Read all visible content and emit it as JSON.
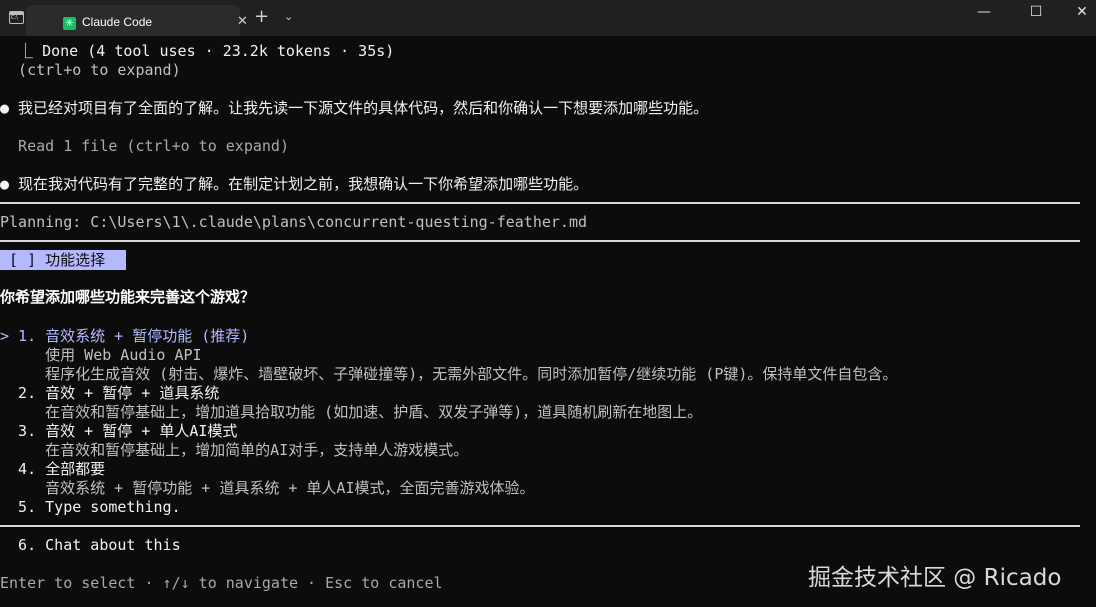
{
  "window": {
    "tab_title": "Claude Code",
    "tab_close": "✕",
    "new_tab": "+",
    "dropdown": "⌄",
    "minimize": "—",
    "maximize": "☐",
    "close": "✕"
  },
  "terminal": {
    "done_line": "  ⎿ Done (4 tool uses · 23.2k tokens · 35s)",
    "expand_hint": "  (ctrl+o to expand)",
    "msg1": "● 我已经对项目有了全面的了解。让我先读一下源文件的具体代码，然后和你确认一下想要添加哪些功能。",
    "read_line": "  Read 1 file (ctrl+o to expand)",
    "msg2": "● 现在我对代码有了完整的了解。在制定计划之前，我想确认一下你希望添加哪些功能。",
    "planning": "Planning: C:\\Users\\1\\.claude\\plans\\concurrent-questing-feather.md",
    "badge": " [ ] 功能选择 ",
    "question": "你希望添加哪些功能来完善这个游戏？",
    "options": [
      {
        "label": "> 1. 音效系统 + 暂停功能 (推荐)",
        "desc": [
          "     使用 Web Audio API",
          "     程序化生成音效 (射击、爆炸、墙壁破坏、子弹碰撞等)，无需外部文件。同时添加暂停/继续功能 (P键)。保持单文件自包含。"
        ]
      },
      {
        "label": "  2. 音效 + 暂停 + 道具系统",
        "desc": [
          "     在音效和暂停基础上，增加道具拾取功能 (如加速、护盾、双发子弹等)，道具随机刷新在地图上。"
        ]
      },
      {
        "label": "  3. 音效 + 暂停 + 单人AI模式",
        "desc": [
          "     在音效和暂停基础上，增加简单的AI对手，支持单人游戏模式。"
        ]
      },
      {
        "label": "  4. 全部都要",
        "desc": [
          "     音效系统 + 暂停功能 + 道具系统 + 单人AI模式，全面完善游戏体验。"
        ]
      },
      {
        "label": "  5. Type something.",
        "desc": []
      }
    ],
    "chat_option": "  6. Chat about this",
    "footer": "Enter to select · ↑/↓ to navigate · Esc to cancel"
  },
  "watermark": "掘金技术社区 @ Ricado"
}
